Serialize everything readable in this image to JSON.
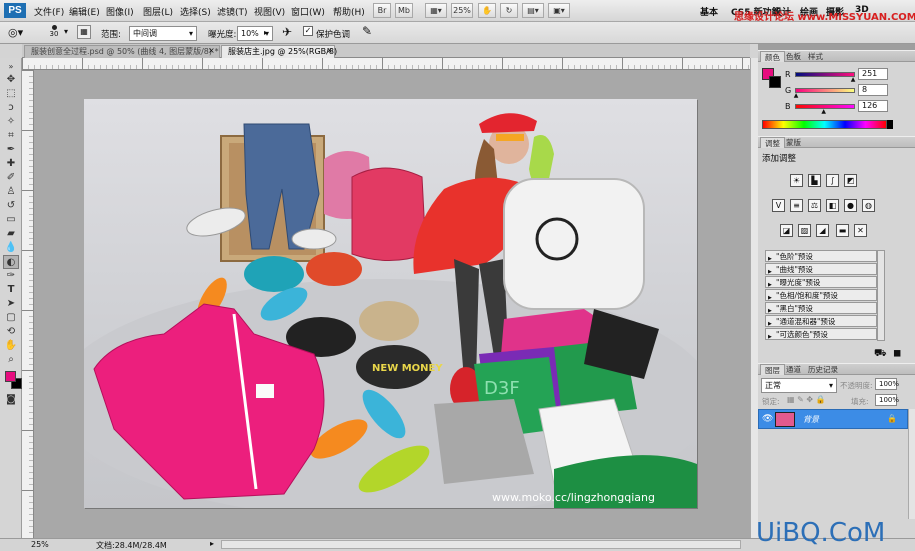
{
  "app": {
    "logo": "PS"
  },
  "menu": [
    "文件(F)",
    "编辑(E)",
    "图像(I)",
    "图层(L)",
    "选择(S)",
    "滤镜(T)",
    "视图(V)",
    "窗口(W)",
    "帮助(H)"
  ],
  "menubar_right": {
    "zoom_value": "25%",
    "workspace": "基本",
    "workspace2": "CS5 新功能",
    "workspace3": "设计",
    "workspace4": "绘画",
    "workspace5": "摄影",
    "workspace6": "3D"
  },
  "watermark": {
    "text": "思缘设计论坛 www.MISSYUAN.COM",
    "corner_text": "UiBQ.CoM"
  },
  "options": {
    "brush_size": "30",
    "range_label": "范围:",
    "range_value": "中间调",
    "exposure_label": "曝光度:",
    "exposure_value": "10%",
    "protect_tones_label": "保护色调"
  },
  "tabs": [
    {
      "label": "服装创意全过程.psd @ 50% (曲线 4, 图层蒙版/8) *",
      "close": "×"
    },
    {
      "label": "服装店主.jpg @ 25%(RGB/8)",
      "close": "×"
    }
  ],
  "image": {
    "url_text": "www.moko.cc/lingzhongqiang",
    "cap_text": "NEW MONEY",
    "shirt_text": "D3F"
  },
  "status": {
    "zoom": "25%",
    "doc": "文档:28.4M/28.4M"
  },
  "colors": {
    "foreground": "#e60c7e",
    "background": "#000000"
  },
  "color_panel": {
    "tabs": [
      "颜色",
      "色板",
      "样式"
    ],
    "channels": [
      {
        "label": "R",
        "value": "251",
        "level": 0.98
      },
      {
        "label": "G",
        "value": "8",
        "level": 0.03
      },
      {
        "label": "B",
        "value": "126",
        "level": 0.49
      }
    ]
  },
  "adjust_panel": {
    "tabs": [
      "调整",
      "蒙版"
    ],
    "title": "添加调整",
    "presets": [
      "\"色阶\"预设",
      "\"曲线\"预设",
      "\"曝光度\"预设",
      "\"色相/饱和度\"预设",
      "\"黑白\"预设",
      "\"通道混和器\"预设",
      "\"可选颜色\"预设"
    ]
  },
  "layers_panel": {
    "tabs": [
      "图层",
      "通道",
      "历史记录"
    ],
    "blend_mode": "正常",
    "opacity_label": "不透明度:",
    "opacity_value": "100%",
    "lock_label": "锁定:",
    "fill_label": "填充:",
    "fill_value": "100%",
    "layers": [
      {
        "name": "背景",
        "selected": true
      }
    ]
  }
}
